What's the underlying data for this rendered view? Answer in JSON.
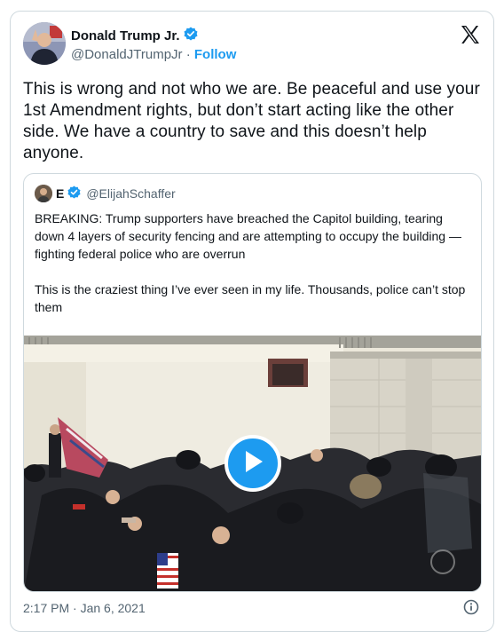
{
  "author": {
    "display_name": "Donald Trump Jr.",
    "handle": "@DonaldJTrumpJr",
    "separator": "·",
    "follow_label": "Follow",
    "verified": true
  },
  "icons": {
    "platform": "x-logo-icon",
    "verified": "verified-badge-icon",
    "play": "play-icon",
    "info": "info-icon"
  },
  "tweet": {
    "text": "This is wrong and not who we are. Be peaceful and use your 1st Amendment rights, but don’t start acting like the other side. We have a country to save and this doesn’t help anyone.",
    "timestamp": "2:17 PM · Jan 6, 2021"
  },
  "quoted": {
    "display_name": "E",
    "handle": "@ElijahSchaffer",
    "verified": true,
    "paragraph_1": "BREAKING: Trump supporters have breached the Capitol building, tearing down 4 layers of security fencing and are attempting to occupy the building — fighting federal police who are overrun",
    "paragraph_2": "This is the craziest thing I’ve ever seen in my life. Thousands, police can’t stop them"
  },
  "colors": {
    "accent": "#1d9bf0",
    "text": "#0f1419",
    "muted": "#536471",
    "border": "#cfd9de"
  }
}
